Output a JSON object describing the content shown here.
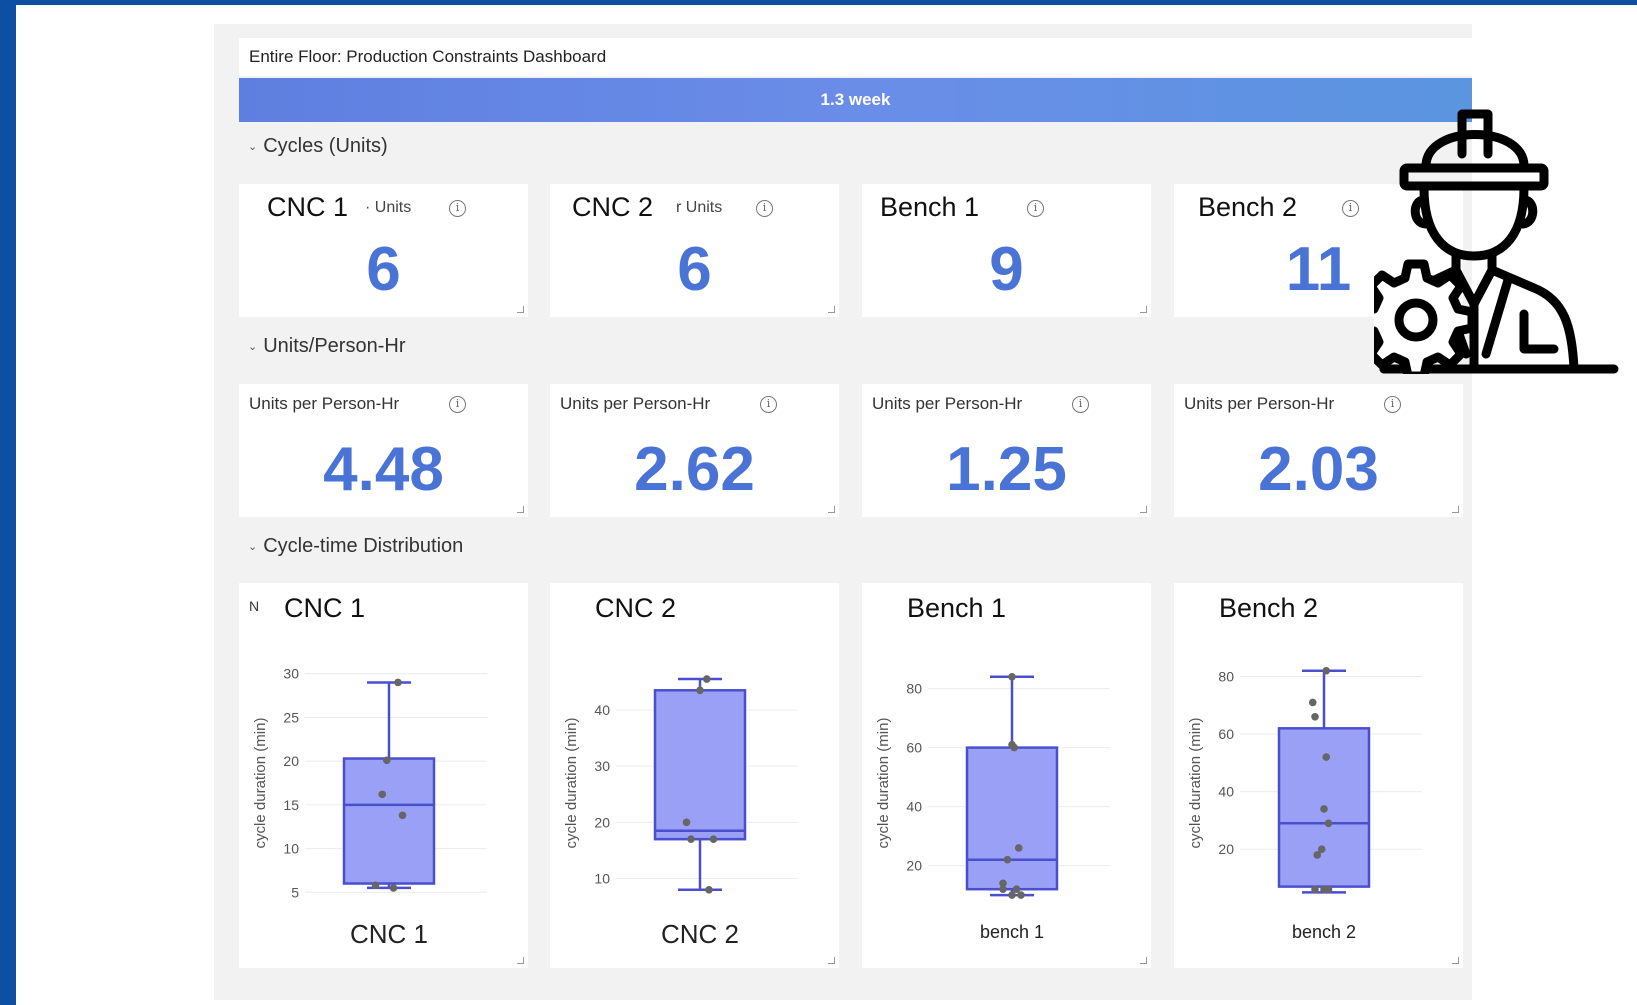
{
  "dashboard": {
    "title": "Entire Floor: Production Constraints Dashboard",
    "time_range": "1.3 week"
  },
  "sections": {
    "cycles": "Cycles (Units)",
    "uph": "Units/Person-Hr",
    "dist": "Cycle-time Distribution"
  },
  "cycles_cards": [
    {
      "title": "CNC 1",
      "sub": "· Units",
      "value": "6"
    },
    {
      "title": "CNC 2",
      "sub": "r Units",
      "value": "6"
    },
    {
      "title": "Bench 1",
      "sub": "",
      "value": "9"
    },
    {
      "title": "Bench 2",
      "sub": "",
      "value": "11"
    }
  ],
  "uph_cards": [
    {
      "title": "Units per Person-Hr",
      "value": "4.48"
    },
    {
      "title": "Units per Person-Hr",
      "value": "2.62"
    },
    {
      "title": "Units per Person-Hr",
      "value": "1.25"
    },
    {
      "title": "Units per Person-Hr",
      "value": "2.03"
    }
  ],
  "icons": {
    "info": "info-icon",
    "caret": "caret-down-icon",
    "worker": "engineer-gear-icon"
  },
  "colors": {
    "accent": "#4a73d6",
    "box_fill": "#9aa0f5",
    "box_stroke": "#4a4fd0",
    "point": "#666666",
    "frame": "#0d4fa3"
  },
  "chart_data": [
    {
      "type": "box",
      "title": "CNC 1",
      "corner_mark": "N",
      "ylabel": "cycle duration (min)",
      "xlabel": "CNC 1",
      "ylim": [
        4,
        31
      ],
      "yticks": [
        5,
        10,
        15,
        20,
        25,
        30
      ],
      "stats": {
        "min": 5.5,
        "q1": 6,
        "median": 15,
        "q3": 20.3,
        "max": 29
      },
      "points": [
        [
          -0.3,
          5.8
        ],
        [
          0.1,
          5.5
        ],
        [
          -0.15,
          16.2
        ],
        [
          0.3,
          13.8
        ],
        [
          -0.05,
          20.1
        ],
        [
          0.2,
          29
        ]
      ]
    },
    {
      "type": "box",
      "title": "CNC 2",
      "ylabel": "cycle duration (min)",
      "xlabel": "CNC 2",
      "ylim": [
        6,
        48
      ],
      "yticks": [
        10,
        20,
        30,
        40
      ],
      "stats": {
        "min": 8,
        "q1": 17,
        "median": 18.5,
        "q3": 43.5,
        "max": 45.5
      },
      "points": [
        [
          -0.3,
          20
        ],
        [
          -0.2,
          17
        ],
        [
          0.3,
          17
        ],
        [
          0.2,
          8
        ],
        [
          0,
          43.5
        ],
        [
          0.15,
          45.5
        ]
      ]
    },
    {
      "type": "box",
      "title": "Bench 1",
      "ylabel": "cycle duration (min)",
      "xlabel": "bench 1",
      "ylim": [
        8,
        88
      ],
      "yticks": [
        20,
        40,
        60,
        80
      ],
      "stats": {
        "min": 10,
        "q1": 12,
        "median": 22,
        "q3": 60,
        "max": 84
      },
      "points": [
        [
          -0.2,
          12
        ],
        [
          -0.2,
          14
        ],
        [
          0.1,
          12
        ],
        [
          0.2,
          10
        ],
        [
          0,
          10
        ],
        [
          -0.1,
          22
        ],
        [
          0.15,
          26
        ],
        [
          0.05,
          60
        ],
        [
          0,
          61
        ],
        [
          0,
          84
        ]
      ]
    },
    {
      "type": "box",
      "title": "Bench 2",
      "ylabel": "cycle duration (min)",
      "xlabel": "bench 2",
      "ylim": [
        2,
        84
      ],
      "yticks": [
        20,
        40,
        60,
        80
      ],
      "stats": {
        "min": 5,
        "q1": 7,
        "median": 29,
        "q3": 62,
        "max": 82
      },
      "points": [
        [
          -0.2,
          6
        ],
        [
          0,
          6
        ],
        [
          0.1,
          6
        ],
        [
          -0.15,
          18
        ],
        [
          -0.05,
          20
        ],
        [
          0,
          34
        ],
        [
          0.1,
          29
        ],
        [
          0.05,
          52
        ],
        [
          -0.2,
          66
        ],
        [
          -0.25,
          71
        ],
        [
          0.05,
          82
        ]
      ]
    }
  ]
}
